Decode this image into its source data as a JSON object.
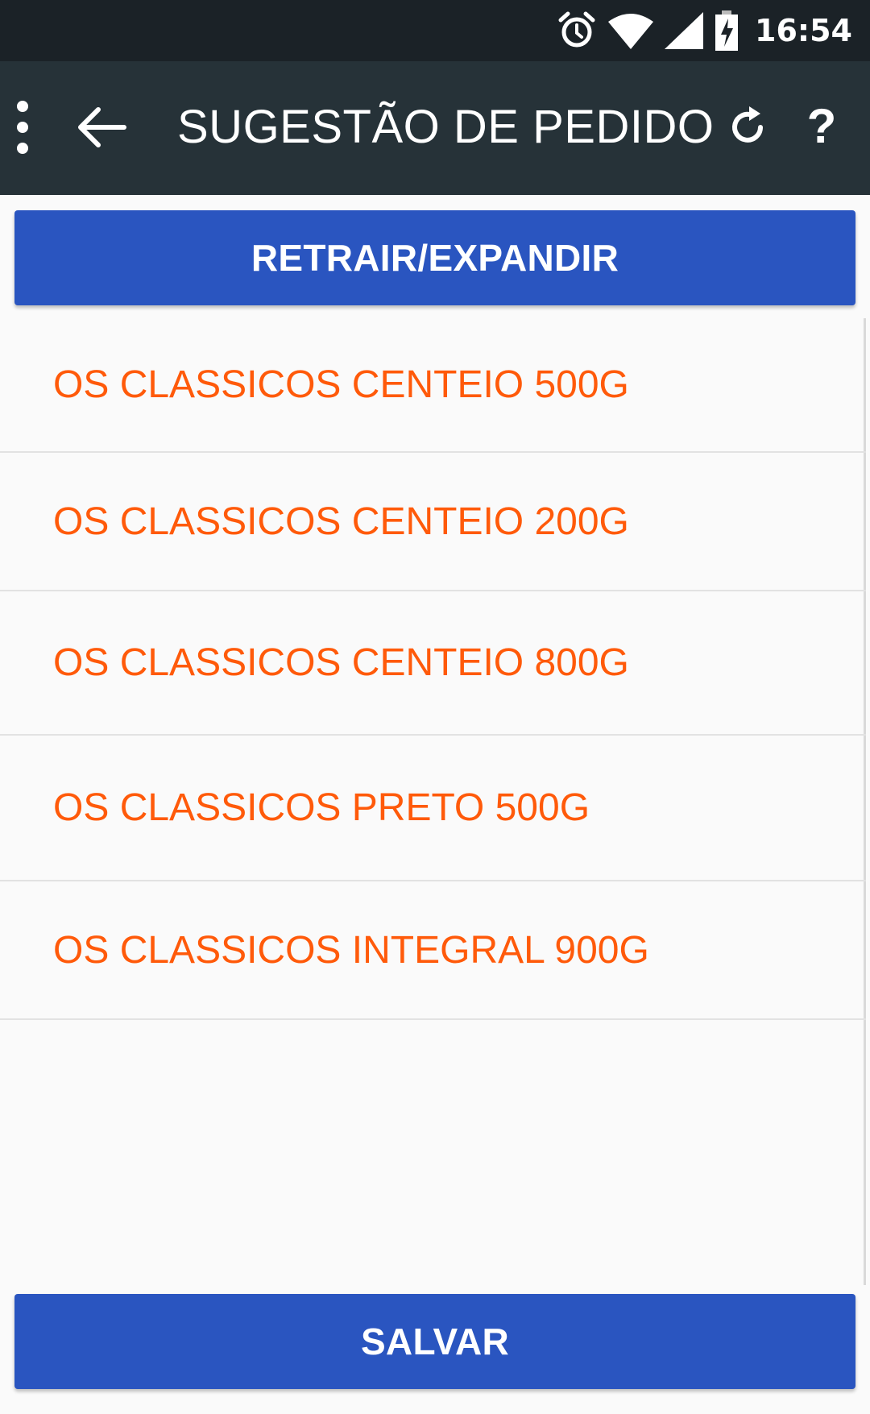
{
  "status_bar": {
    "time": "16:54",
    "icons": [
      "alarm-icon",
      "wifi-icon",
      "signal-icon",
      "battery-charging-icon"
    ]
  },
  "toolbar": {
    "title": "SUGESTÃO DE PEDIDO",
    "menu_icon": "more-vert-icon",
    "back_icon": "arrow-back-icon",
    "refresh_icon": "refresh-icon",
    "help_label": "?"
  },
  "actions": {
    "expand_label": "RETRAIR/EXPANDIR",
    "save_label": "SALVAR"
  },
  "products": [
    "OS CLASSICOS CENTEIO 500G",
    "OS CLASSICOS CENTEIO 200G",
    "OS CLASSICOS CENTEIO 800G",
    "OS CLASSICOS PRETO 500G",
    "OS CLASSICOS INTEGRAL 900G"
  ],
  "colors": {
    "status_bar": "#1b2227",
    "toolbar": "#263238",
    "button": "#2a55c0",
    "item_text": "#ff5a0a",
    "background": "#fafafa"
  }
}
